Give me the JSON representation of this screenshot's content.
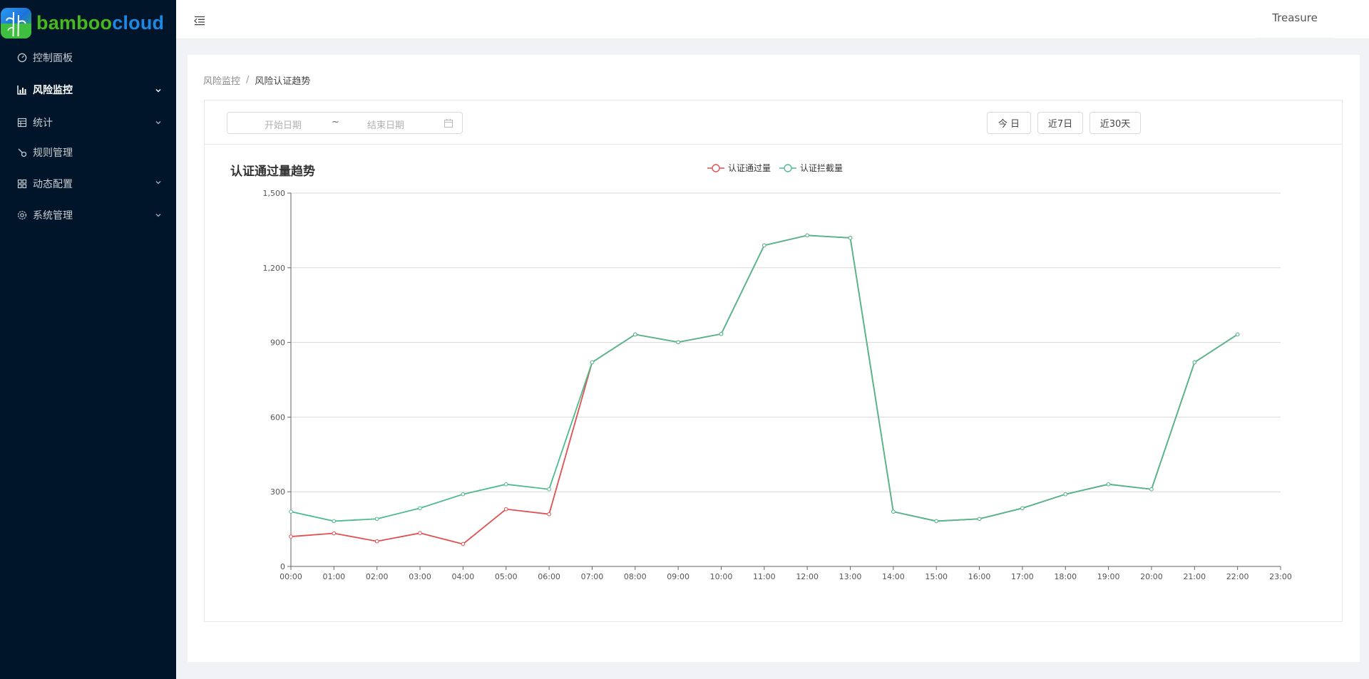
{
  "brand": {
    "part1": "bamboo",
    "part2": "cloud",
    "color1": "#45b91d",
    "color2": "#1e88e5"
  },
  "sidebar": {
    "items": [
      {
        "label": "控制面板",
        "icon": "dashboard-icon",
        "has_arrow": false,
        "active": false
      },
      {
        "label": "风险监控",
        "icon": "bar-chart-icon",
        "has_arrow": true,
        "active": true
      },
      {
        "label": "统计",
        "icon": "table-icon",
        "has_arrow": true,
        "active": false
      },
      {
        "label": "规则管理",
        "icon": "rule-icon",
        "has_arrow": false,
        "active": false
      },
      {
        "label": "动态配置",
        "icon": "grid-icon",
        "has_arrow": true,
        "active": false
      },
      {
        "label": "系统管理",
        "icon": "gear-icon",
        "has_arrow": true,
        "active": false
      }
    ]
  },
  "header": {
    "user": "Treasure"
  },
  "breadcrumb": {
    "parent": "风险监控",
    "separator": "/",
    "current": "风险认证趋势"
  },
  "toolbar": {
    "start_placeholder": "开始日期",
    "tilde": "~",
    "end_placeholder": "结束日期",
    "buttons": [
      "今 日",
      "近7日",
      "近30天"
    ]
  },
  "chart_data": {
    "type": "line",
    "title": "认证通过量趋势",
    "legend_position": "top-center",
    "x": [
      "00:00",
      "01:00",
      "02:00",
      "03:00",
      "04:00",
      "05:00",
      "06:00",
      "07:00",
      "08:00",
      "09:00",
      "10:00",
      "11:00",
      "12:00",
      "13:00",
      "14:00",
      "15:00",
      "16:00",
      "17:00",
      "18:00",
      "19:00",
      "20:00",
      "21:00",
      "22:00",
      "23:00"
    ],
    "ylim": [
      0,
      1500
    ],
    "yticks": [
      0,
      300,
      600,
      900,
      1200,
      1500
    ],
    "ytick_labels": [
      "0",
      "300",
      "600",
      "900",
      "1,200",
      "1,500"
    ],
    "grid": true,
    "series": [
      {
        "name": "认证通过量",
        "color": "#e05050",
        "values": [
          120,
          133,
          101,
          134,
          90,
          230,
          210,
          820,
          932,
          901,
          934,
          1290,
          1330,
          1320,
          220,
          182,
          191,
          234,
          290,
          330,
          310,
          820,
          932
        ]
      },
      {
        "name": "认证拦截量",
        "color": "#4fba8e",
        "values": [
          220,
          182,
          191,
          234,
          290,
          330,
          310,
          820,
          932,
          901,
          934,
          1290,
          1330,
          1320,
          220,
          182,
          191,
          234,
          290,
          330,
          310,
          820,
          932
        ]
      }
    ]
  }
}
